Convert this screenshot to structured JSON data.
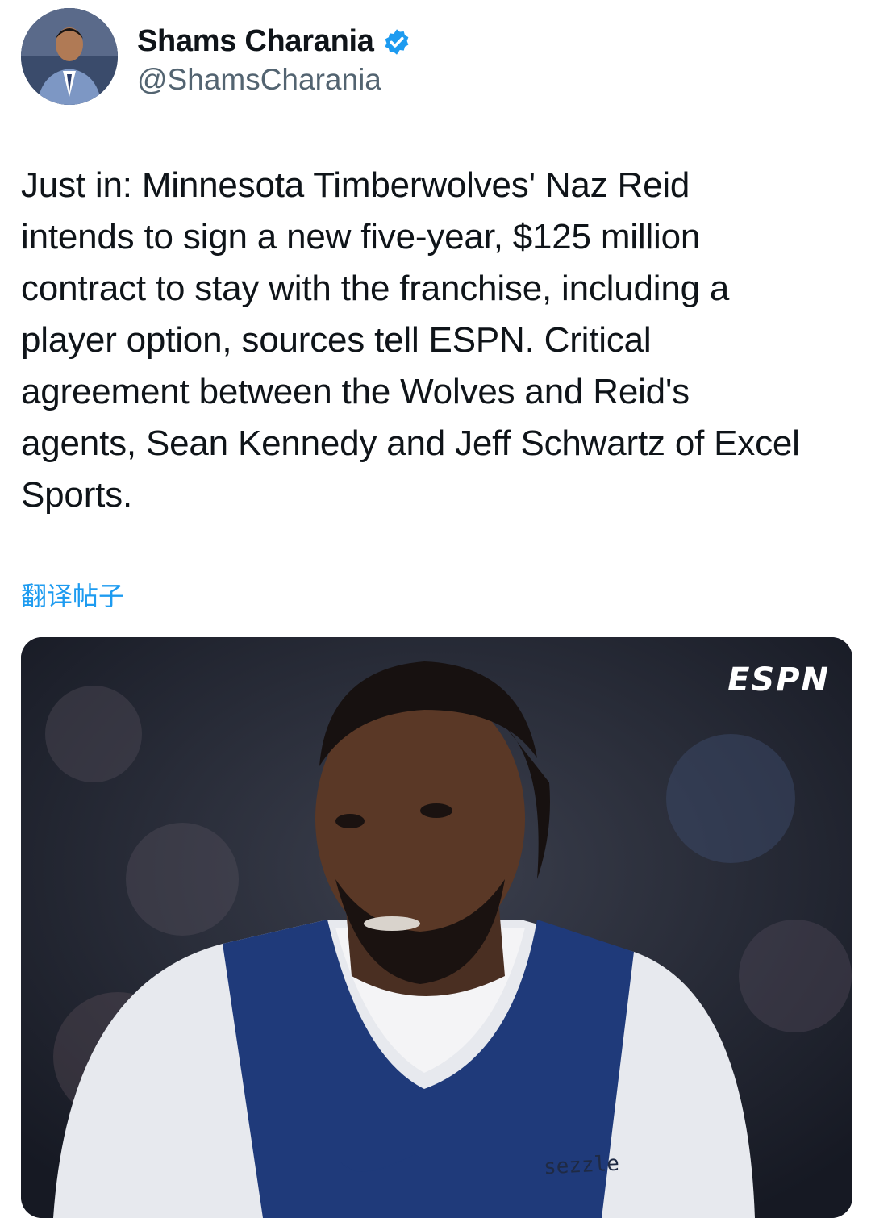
{
  "author": {
    "display_name": "Shams Charania",
    "handle": "@ShamsCharania",
    "verified": true,
    "avatar_icon": "author-avatar"
  },
  "tweet": {
    "text": "Just in: Minnesota Timberwolves' Naz Reid\nintends to sign a new five-year, $125 million\ncontract to stay with the franchise, including a\nplayer option, sources tell ESPN. Critical\nagreement between the Wolves and Reid's\nagents, Sean Kennedy and Jeff Schwartz of Excel\nSports.",
    "translate_label": "翻译帖子"
  },
  "media": {
    "logo_text": "ESPN",
    "sponsor_text": "sezzle",
    "description_icon": "player-photo"
  },
  "colors": {
    "accent": "#1d9bf0",
    "handle": "#536471",
    "text": "#0f1419",
    "jersey": "#1f3a7a"
  }
}
